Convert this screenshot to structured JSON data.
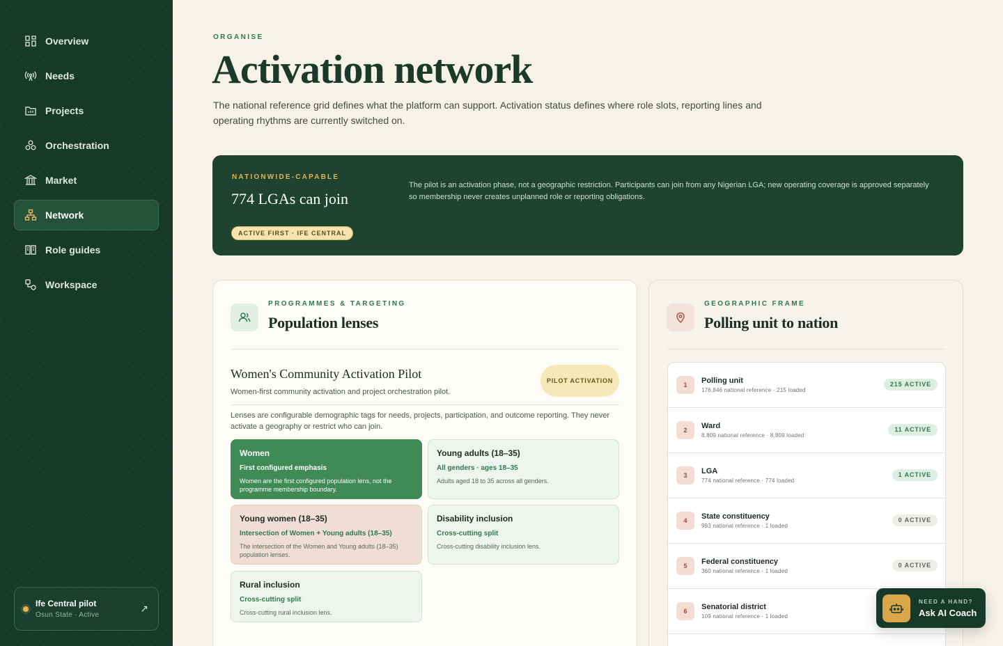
{
  "sidebar": {
    "items": [
      {
        "label": "Overview",
        "icon": "grid-icon"
      },
      {
        "label": "Needs",
        "icon": "broadcast-icon"
      },
      {
        "label": "Projects",
        "icon": "folder-chart-icon"
      },
      {
        "label": "Orchestration",
        "icon": "cluster-icon"
      },
      {
        "label": "Market",
        "icon": "bank-icon"
      },
      {
        "label": "Network",
        "icon": "network-icon",
        "active": true
      },
      {
        "label": "Role guides",
        "icon": "book-icon"
      },
      {
        "label": "Workspace",
        "icon": "workspace-icon"
      }
    ],
    "pilot": {
      "title": "Ife Central pilot",
      "subtitle": "Osun State · Active"
    }
  },
  "header": {
    "eyebrow": "ORGANISE",
    "title": "Activation network",
    "description": "The national reference grid defines what the platform can support. Activation status defines where role slots, reporting lines and operating rhythms are currently switched on."
  },
  "banner": {
    "eyebrow": "NATIONWIDE-CAPABLE",
    "title": "774 LGAs can join",
    "badge": "ACTIVE FIRST · IFE CENTRAL",
    "description": "The pilot is an activation phase, not a geographic restriction. Participants can join from any Nigerian LGA; new operating coverage is approved separately so membership never creates unplanned role or reporting obligations."
  },
  "population": {
    "eyebrow": "PROGRAMMES & TARGETING",
    "title": "Population lenses",
    "pilot_name": "Women's Community Activation Pilot",
    "pilot_desc": "Women-first community activation and project orchestration pilot.",
    "pilot_badge": "PILOT ACTIVATION",
    "note": "Lenses are configurable demographic tags for needs, projects, participation, and outcome reporting. They never activate a geography or restrict who can join.",
    "lenses": [
      {
        "title": "Women",
        "sub": "First configured emphasis",
        "text": "Women are the first configured population lens, not the programme membership boundary."
      },
      {
        "title": "Young adults (18–35)",
        "sub": "All genders · ages 18–35",
        "text": "Adults aged 18 to 35 across all genders."
      },
      {
        "title": "Young women (18–35)",
        "sub": "Intersection of Women + Young adults (18–35)",
        "text": "The intersection of the Women and Young adults (18–35) population lenses."
      },
      {
        "title": "Disability inclusion",
        "sub": "Cross-cutting split",
        "text": "Cross-cutting disability inclusion lens."
      },
      {
        "title": "Rural inclusion",
        "sub": "Cross-cutting split",
        "text": "Cross-cutting rural inclusion lens."
      }
    ]
  },
  "geo": {
    "eyebrow": "GEOGRAPHIC FRAME",
    "title": "Polling unit to nation",
    "rows": [
      {
        "num": "1",
        "name": "Polling unit",
        "meta": "176,846 national reference · 215 loaded",
        "badge": "215 ACTIVE"
      },
      {
        "num": "2",
        "name": "Ward",
        "meta": "8,809 national reference · 8,809 loaded",
        "badge": "11 ACTIVE"
      },
      {
        "num": "3",
        "name": "LGA",
        "meta": "774 national reference · 774 loaded",
        "badge": "1 ACTIVE"
      },
      {
        "num": "4",
        "name": "State constituency",
        "meta": "993 national reference · 1 loaded",
        "badge": "0 ACTIVE"
      },
      {
        "num": "5",
        "name": "Federal constituency",
        "meta": "360 national reference · 1 loaded",
        "badge": "0 ACTIVE"
      },
      {
        "num": "6",
        "name": "Senatorial district",
        "meta": "109 national reference · 1 loaded",
        "badge": ""
      }
    ]
  },
  "coach": {
    "eyebrow": "NEED A HAND?",
    "label": "Ask AI Coach"
  },
  "colors": {
    "sidebar": "#17392a",
    "accent": "#2f7a4a",
    "gold": "#e3b24c",
    "primary_lens": "#3f8a55"
  }
}
